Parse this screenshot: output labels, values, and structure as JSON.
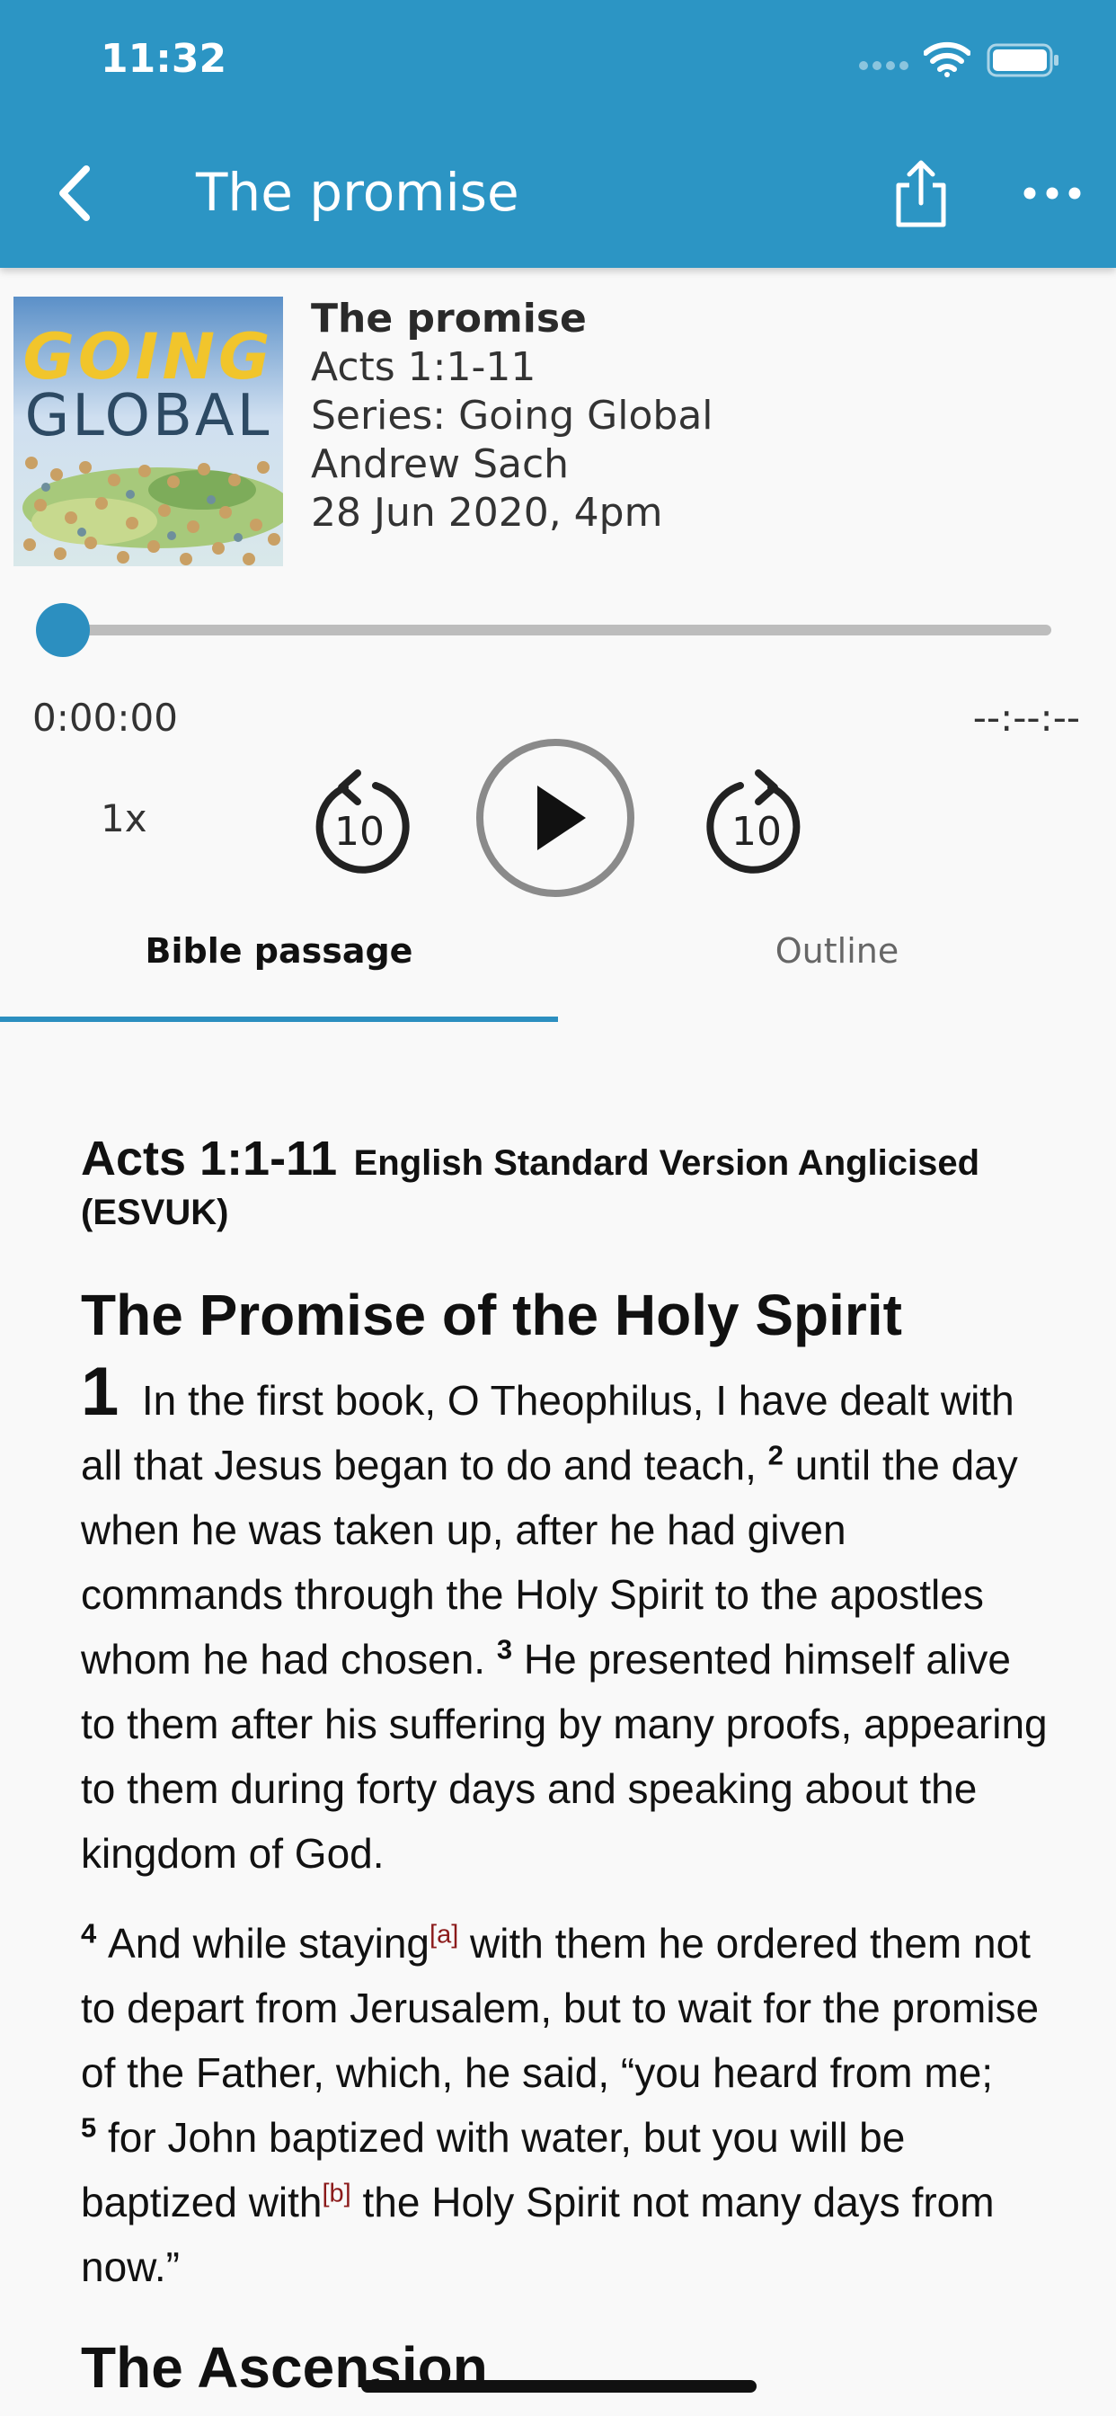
{
  "status_bar": {
    "time": "11:32"
  },
  "nav": {
    "title": "The promise"
  },
  "artwork": {
    "word1": "GOING",
    "word2": "GLOBAL"
  },
  "sermon": {
    "title": "The promise",
    "passage": "Acts 1:1-11",
    "series": "Series: Going Global",
    "speaker": "Andrew Sach",
    "date": "28 Jun 2020, 4pm"
  },
  "player": {
    "elapsed": "0:00:00",
    "total": "--:--:--",
    "progress": 0,
    "speed": "1x",
    "rewind_seconds": "10",
    "forward_seconds": "10"
  },
  "tabs": {
    "bible": "Bible passage",
    "outline": "Outline"
  },
  "passage": {
    "reference": "Acts 1:1-11",
    "version": "English Standard Version Anglicised (ESVUK)",
    "heading": "The Promise of the Holy Spirit",
    "chapter": "1",
    "p1": {
      "v1": "In the first book, O Theophilus, I have dealt with all that Jesus began to do and teach, ",
      "n2": "2",
      "v2": "until the day when he was taken up, after he had given commands through the Holy Spirit to the apostles whom he had chosen. ",
      "n3": "3",
      "v3": "He presented himself alive to them after his suffering by many proofs, appearing to them during forty days and speaking about the kingdom of God."
    },
    "p2": {
      "n4": "4",
      "v4a": "And while staying",
      "fa": "[a]",
      "v4b": " with them he ordered them not to depart from Jerusalem, but to wait for the promise of the Father, which, he said, “you heard from me; ",
      "n5": "5",
      "v5a": "for John baptized with water, but you will be baptized with",
      "fb": "[b]",
      "v5b": " the Holy Spirit not many days from now.”"
    },
    "next_heading": "The Ascension"
  },
  "colors": {
    "header": "#2c95c4",
    "accent": "#2c8fc0",
    "artwork_title": "#f1c52c"
  },
  "icons": [
    "chevron-left-icon",
    "share-icon",
    "more-icon",
    "signal-icon",
    "wifi-icon",
    "battery-icon",
    "rewind-10-icon",
    "play-icon",
    "forward-10-icon"
  ]
}
